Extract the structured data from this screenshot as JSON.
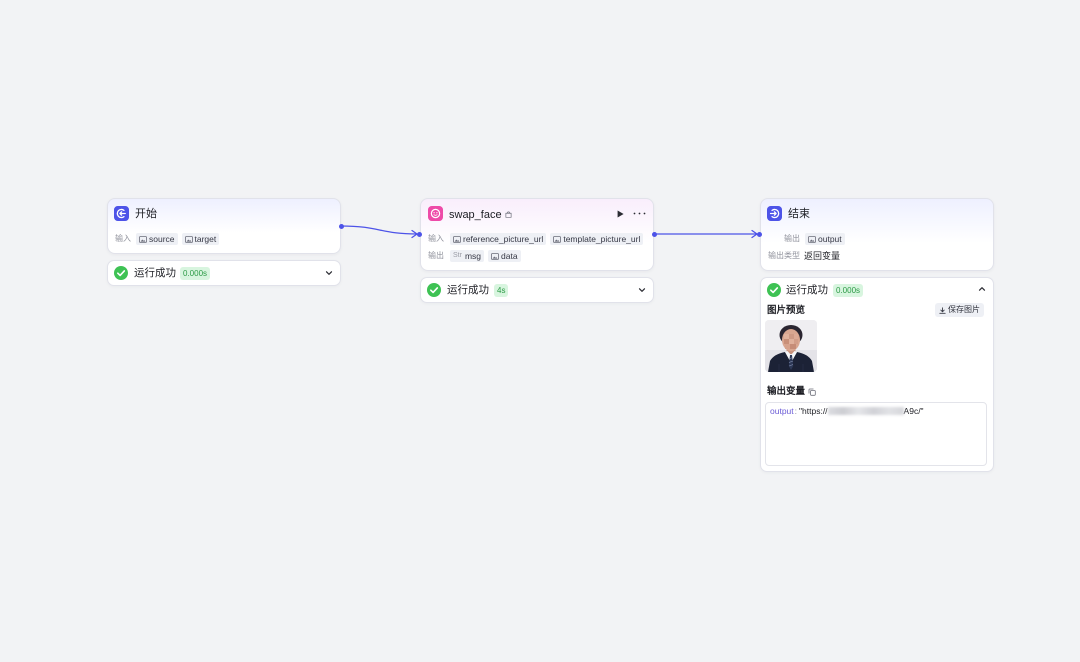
{
  "canvas": {
    "background": "#f2f3f5"
  },
  "colors": {
    "accent": "#4d53e8",
    "success": "#3ec254",
    "success_badge_bg": "#d8f5df",
    "success_badge_text": "#2b9a45",
    "plugin_icon": "#ee4aa8",
    "variable_key": "#6b5bd6"
  },
  "nodes": {
    "start": {
      "title": "开始",
      "icon": "start-icon",
      "input_label": "输入",
      "inputs": [
        {
          "name": "source",
          "type_icon": "image-icon"
        },
        {
          "name": "target",
          "type_icon": "image-icon"
        }
      ],
      "result": {
        "status_icon": "success-check-icon",
        "status": "运行成功",
        "duration": "0.000s",
        "expanded": false
      }
    },
    "swap_face": {
      "title": "swap_face",
      "icon": "plugin-face-icon",
      "title_badge_icon": "plugin-store-icon",
      "actions": {
        "run_icon": "play-icon",
        "more_icon": "more-icon"
      },
      "input_label": "输入",
      "inputs": [
        {
          "name": "reference_picture_url",
          "type_icon": "image-icon"
        },
        {
          "name": "template_picture_url",
          "type_icon": "image-icon"
        }
      ],
      "output_label": "输出",
      "outputs": [
        {
          "type_prefix": "Str",
          "name": "msg"
        },
        {
          "name": "data",
          "type_icon": "image-icon"
        }
      ],
      "result": {
        "status_icon": "success-check-icon",
        "status": "运行成功",
        "duration": "4s",
        "expanded": false
      }
    },
    "end": {
      "title": "结束",
      "icon": "end-icon",
      "output_label": "输出",
      "outputs": [
        {
          "name": "output",
          "type_icon": "image-icon"
        }
      ],
      "output_type_label": "输出类型",
      "output_type_value": "返回变量",
      "result": {
        "status_icon": "success-check-icon",
        "status": "运行成功",
        "duration": "0.000s",
        "expanded": true,
        "image_preview_label": "图片预览",
        "save_image_icon": "download-icon",
        "save_image_label": "保存图片",
        "output_vars_label": "输出变量",
        "copy_icon": "copy-icon",
        "output_key": "output",
        "output_separator": ":",
        "output_value_start": "\"https://",
        "output_value_end": "A9c/\""
      }
    }
  }
}
